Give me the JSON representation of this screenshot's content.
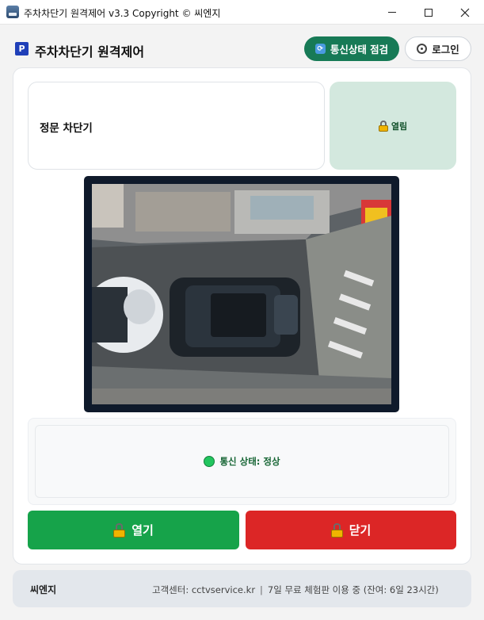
{
  "window": {
    "title": "주차차단기 원격제어 v3.3 Copyright © 씨엔지",
    "minimize": "–",
    "maximize": "□",
    "close": "✕"
  },
  "header": {
    "brand_icon": "P",
    "title": "주차차단기 원격제어",
    "check_button": "통신상태 점검",
    "login_button": "로그인"
  },
  "gate": {
    "name": "정문 차단기",
    "state": "열림",
    "state_icon": "lock-icon"
  },
  "camera": {
    "feed": "cctv-camera-feed"
  },
  "status": {
    "text": "통신 상태: 정상",
    "color": "#22c55e"
  },
  "controls": {
    "open_label": "열기",
    "close_label": "닫기",
    "open_color": "#16a34a",
    "close_color": "#dc2626"
  },
  "footer": {
    "brand": "씨엔지",
    "support": "고객센터: cctvservice.kr",
    "trial": "7일 무료 체험판 이용 중 (잔여: 6일 23시간)"
  }
}
